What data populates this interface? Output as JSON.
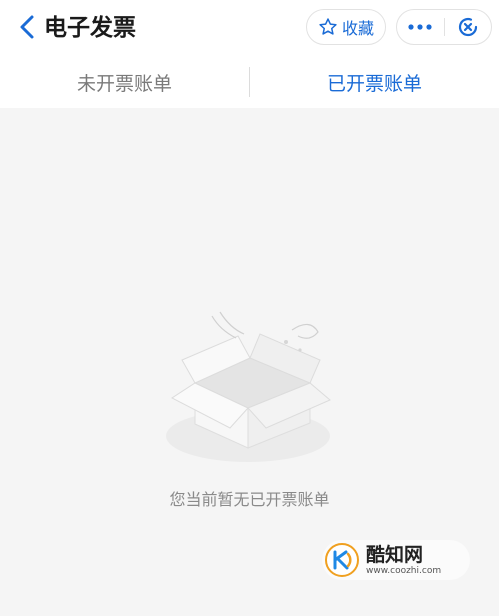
{
  "header": {
    "title": "电子发票",
    "favorite_label": "收藏",
    "back_icon": "chevron-left-icon",
    "more_icon": "more-dots-icon",
    "close_icon": "target-close-icon",
    "accent_color": "#1a6bd6"
  },
  "tabs": [
    {
      "label": "未开票账单",
      "active": false
    },
    {
      "label": "已开票账单",
      "active": true
    }
  ],
  "empty_state": {
    "icon": "empty-box-icon",
    "message": "您当前暂无已开票账单"
  },
  "watermark": {
    "name": "酷知网",
    "url": "www.coozhi.com"
  }
}
